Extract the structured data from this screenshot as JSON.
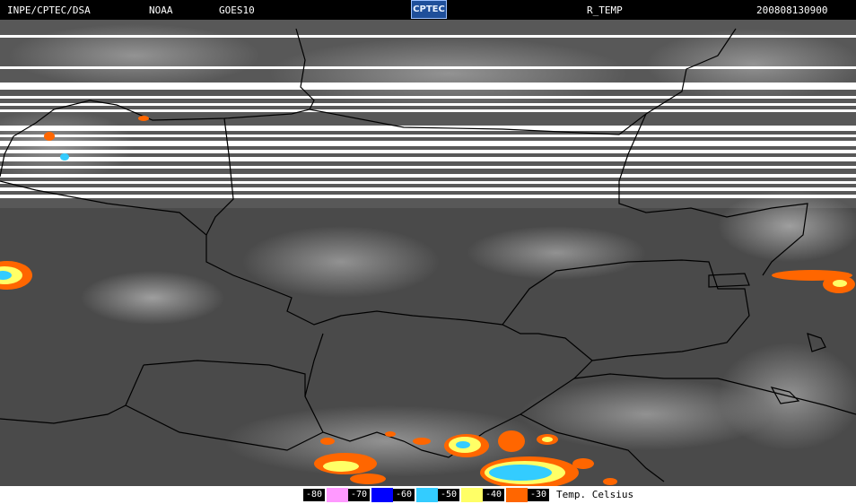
{
  "header": {
    "source": "INPE/CPTEC/DSA",
    "agency": "NOAA",
    "satellite": "GOES10",
    "logo": "CPTEC",
    "product": "R_TEMP",
    "timestamp": "200808130900"
  },
  "legend": {
    "title": "Temp. Celsius",
    "stops": [
      {
        "label": "-80",
        "color": "#ff99ff"
      },
      {
        "label": "-70",
        "color": "#0000ff"
      },
      {
        "label": "-60",
        "color": "#33ccff"
      },
      {
        "label": "-50",
        "color": "#ffff66"
      },
      {
        "label": "-40",
        "color": "#ff6600"
      },
      {
        "label": "-30",
        "color": "#000000"
      }
    ]
  },
  "colors": {
    "background_cloud": "#4b4b4b",
    "border_line": "#000000",
    "scan_gap": "#ffffff"
  }
}
